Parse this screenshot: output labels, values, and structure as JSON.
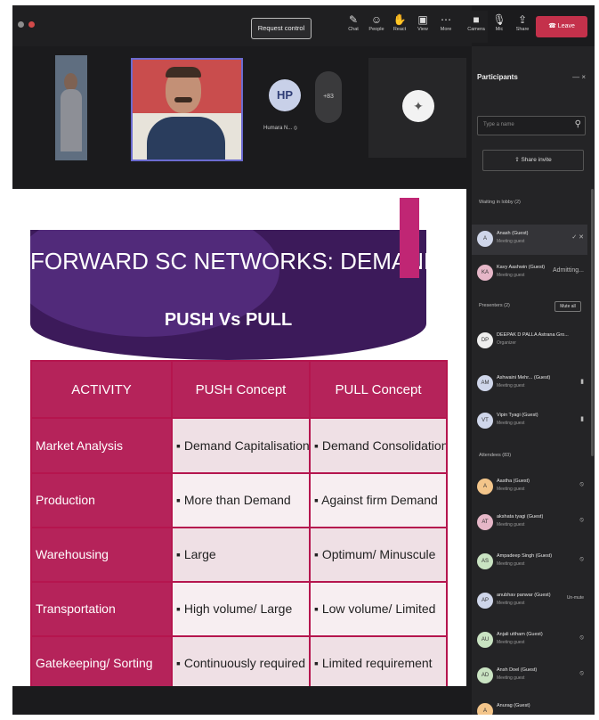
{
  "toolbar": {
    "request_control": "Request control",
    "items": [
      {
        "label": "Chat",
        "icon": "chat-icon"
      },
      {
        "label": "People",
        "icon": "people-icon"
      },
      {
        "label": "React",
        "icon": "react-icon"
      },
      {
        "label": "View",
        "icon": "view-icon"
      },
      {
        "label": "More",
        "icon": "more-icon"
      },
      {
        "label": "Camera",
        "icon": "camera-icon"
      },
      {
        "label": "Mic",
        "icon": "mic-icon"
      },
      {
        "label": "Share",
        "icon": "share-icon"
      }
    ],
    "leave": "Leave",
    "leave_color": "#c4314b"
  },
  "videos": {
    "hp_initials": "HP",
    "hp_name": "Humara N... ",
    "more_count": "+83"
  },
  "participants": {
    "title": "Participants",
    "search_placeholder": "Type a name",
    "share_invite": "Share invite",
    "sections": {
      "waiting": "Waiting in lobby (2)",
      "presenters": "Presenters (2)",
      "attendees": "Attendees (83)"
    },
    "mute_all": "Mute all",
    "lobby": [
      {
        "initials": "A",
        "name": "Anash (Guest)",
        "status": "Meeting guest",
        "right": ""
      },
      {
        "initials": "KA",
        "name": "Kavy Aashwin (Guest)",
        "status": "Meeting guest",
        "right": "Admitting..."
      }
    ],
    "presenters": [
      {
        "initials": "DP",
        "name": "DEEPAK D PALLA Astrana Gro...",
        "status": "Organizer",
        "right": ""
      },
      {
        "initials": "AM",
        "name": "Ashwaini Mehr... (Guest)",
        "status": "Meeting guest",
        "right": ""
      },
      {
        "initials": "VT",
        "name": "Vipin Tyagi (Guest)",
        "status": "Meeting guest",
        "right": ""
      }
    ],
    "attendees": [
      {
        "initials": "A",
        "name": "Aastha (Guest)",
        "status": "Meeting guest",
        "right": ""
      },
      {
        "initials": "AT",
        "name": "akshata tyagi (Guest)",
        "status": "Meeting guest",
        "right": ""
      },
      {
        "initials": "AS",
        "name": "Ampadeep Singh (Guest)",
        "status": "Meeting guest",
        "right": ""
      },
      {
        "initials": "AP",
        "name": "anubhav panwar (Guest)",
        "status": "Meeting guest",
        "right": "Un-mute"
      },
      {
        "initials": "AU",
        "name": "Anjali uttham (Guest)",
        "status": "Meeting guest",
        "right": ""
      },
      {
        "initials": "AD",
        "name": "Ansh Doel (Guest)",
        "status": "Meeting guest",
        "right": ""
      },
      {
        "initials": "A",
        "name": "Anurag (Guest)",
        "status": "",
        "right": ""
      }
    ]
  },
  "slide": {
    "title": "FORWARD SC NETWORKS: DEMAND BASED",
    "subtitle": "PUSH Vs PULL",
    "accent_color": "#c02674",
    "banner_color": "#3c1a5a",
    "headers": [
      "ACTIVITY",
      "PUSH Concept",
      "PULL Concept"
    ],
    "rows": [
      {
        "activity": "Market Analysis",
        "push": "▪ Demand Capitalisation",
        "pull": "▪ Demand Consolidation"
      },
      {
        "activity": "Production",
        "push": "▪ More than Demand",
        "pull": "▪ Against firm Demand"
      },
      {
        "activity": "Warehousing",
        "push": "▪ Large",
        "pull": "▪ Optimum/ Minuscule"
      },
      {
        "activity": "Transportation",
        "push": "▪ High volume/ Large",
        "pull": "▪ Low volume/ Limited"
      },
      {
        "activity": "Gatekeeping/ Sorting",
        "push": "▪ Continuously required",
        "pull": "▪ Limited requirement"
      }
    ]
  }
}
